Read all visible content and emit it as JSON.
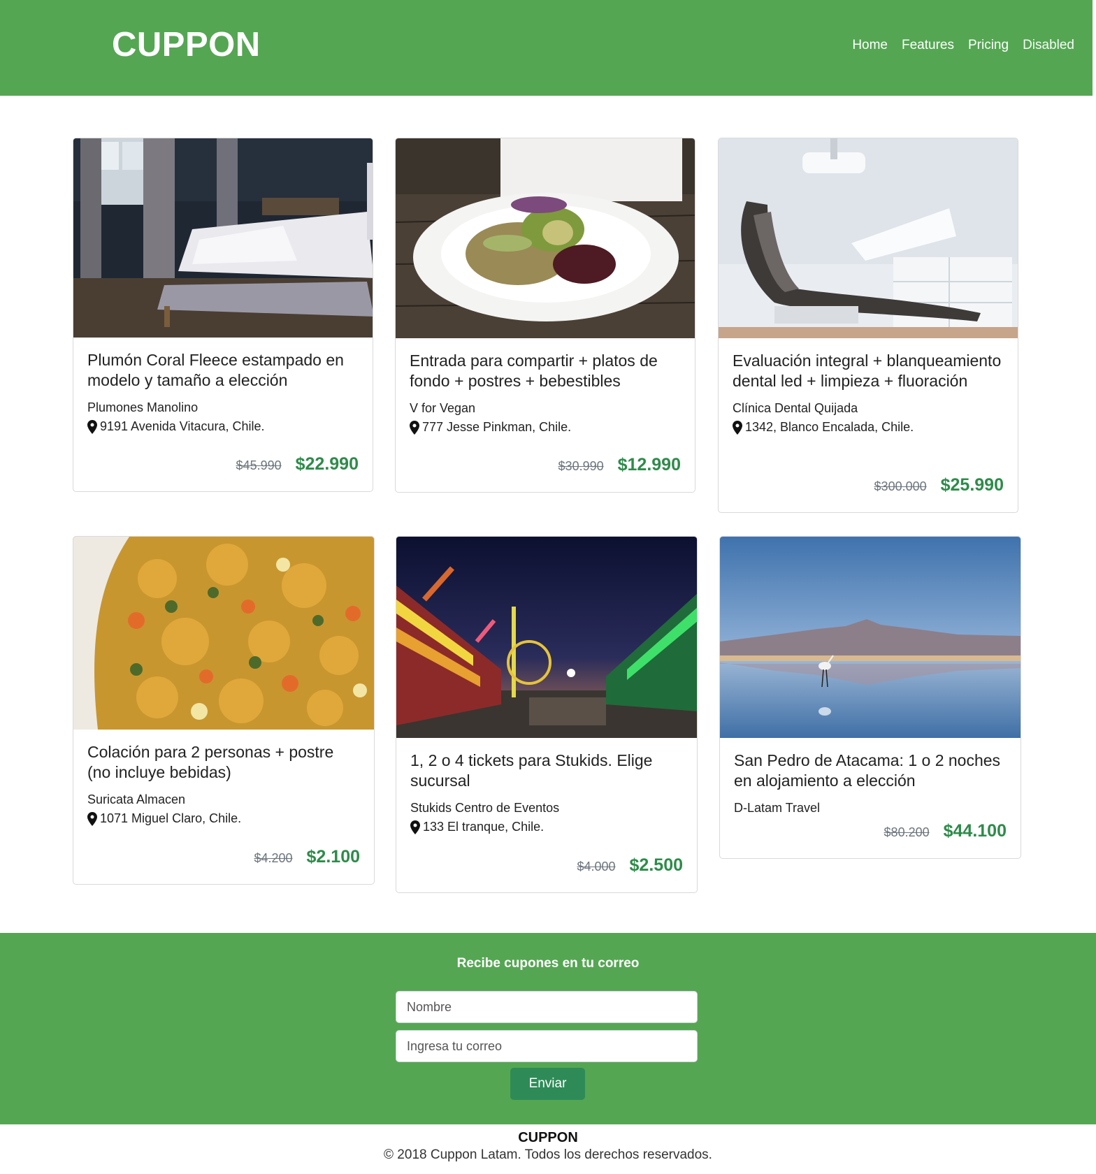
{
  "header": {
    "brand": "CUPPON",
    "nav": [
      "Home",
      "Features",
      "Pricing",
      "Disabled"
    ]
  },
  "deals": [
    {
      "title": "Plumón Coral Fleece estampado en modelo y tamaño a elección",
      "company": "Plumones Manolino",
      "address": "9191 Avenida Vitacura, Chile.",
      "old_price": "$45.990",
      "price": "$22.990",
      "image": "bedroom-photo"
    },
    {
      "title": "Entrada para compartir + platos de fondo + postres + bebestibles",
      "company": "V for Vegan",
      "address": "777 Jesse Pinkman, Chile.",
      "old_price": "$30.990",
      "price": "$12.990",
      "image": "vegan-salad-photo"
    },
    {
      "title": "Evaluación integral + blanqueamiento dental led + limpieza + fluoración",
      "company": "Clínica Dental Quijada",
      "address": "1342, Blanco Encalada, Chile.",
      "old_price": "$300.000",
      "price": "$25.990",
      "image": "dental-chair-photo"
    },
    {
      "title": "Colación para 2 personas + postre (no incluye bebidas)",
      "company": "Suricata Almacen",
      "address": "1071 Miguel Claro, Chile.",
      "old_price": "$4.200",
      "price": "$2.100",
      "image": "food-dish-photo"
    },
    {
      "title": "1, 2 o 4 tickets para Stukids. Elige sucursal",
      "company": "Stukids Centro de Eventos",
      "address": "133 El tranque, Chile.",
      "old_price": "$4.000",
      "price": "$2.500",
      "image": "fair-night-photo"
    },
    {
      "title": "San Pedro de Atacama: 1 o 2 noches en alojamiento a elección",
      "company": "D-Latam Travel",
      "old_price": "$80.200",
      "price": "$44.100",
      "image": "flamingo-lagoon-photo"
    }
  ],
  "subscribe": {
    "title": "Recibe cupones en tu correo",
    "name_placeholder": "Nombre",
    "email_placeholder": "Ingresa tu correo",
    "button": "Enviar"
  },
  "footer": {
    "brand": "CUPPON",
    "copyright": "© 2018 Cuppon Latam. Todos los derechos reservados."
  },
  "colors": {
    "brand_green": "#55a653",
    "price_green": "#2e8b4a",
    "button_green": "#2e8b57"
  }
}
